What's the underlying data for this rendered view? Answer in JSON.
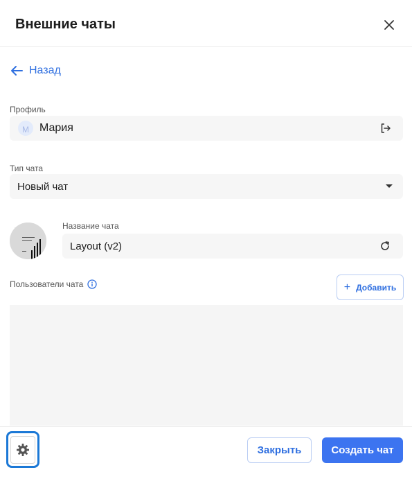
{
  "dialog": {
    "title": "Внешние чаты",
    "back_label": "Назад"
  },
  "profile": {
    "label": "Профиль",
    "avatar_initial": "М",
    "name": "Мария"
  },
  "chat_type": {
    "label": "Тип чата",
    "value": "Новый чат"
  },
  "chat_name": {
    "label": "Название чата",
    "value": "Layout (v2)"
  },
  "users": {
    "label": "Пользователи чата",
    "add_label": "Добавить"
  },
  "footer": {
    "close_label": "Закрыть",
    "create_label": "Создать чат"
  },
  "colors": {
    "accent": "#3c74f0",
    "link": "#2f6fe0",
    "focus_ring": "#1b78d6",
    "field_bg": "#f6f6f6"
  },
  "icons": [
    "close-icon",
    "arrow-left-icon",
    "logout-icon",
    "chevron-down-icon",
    "refresh-icon",
    "info-icon",
    "plus-icon",
    "gear-icon"
  ]
}
